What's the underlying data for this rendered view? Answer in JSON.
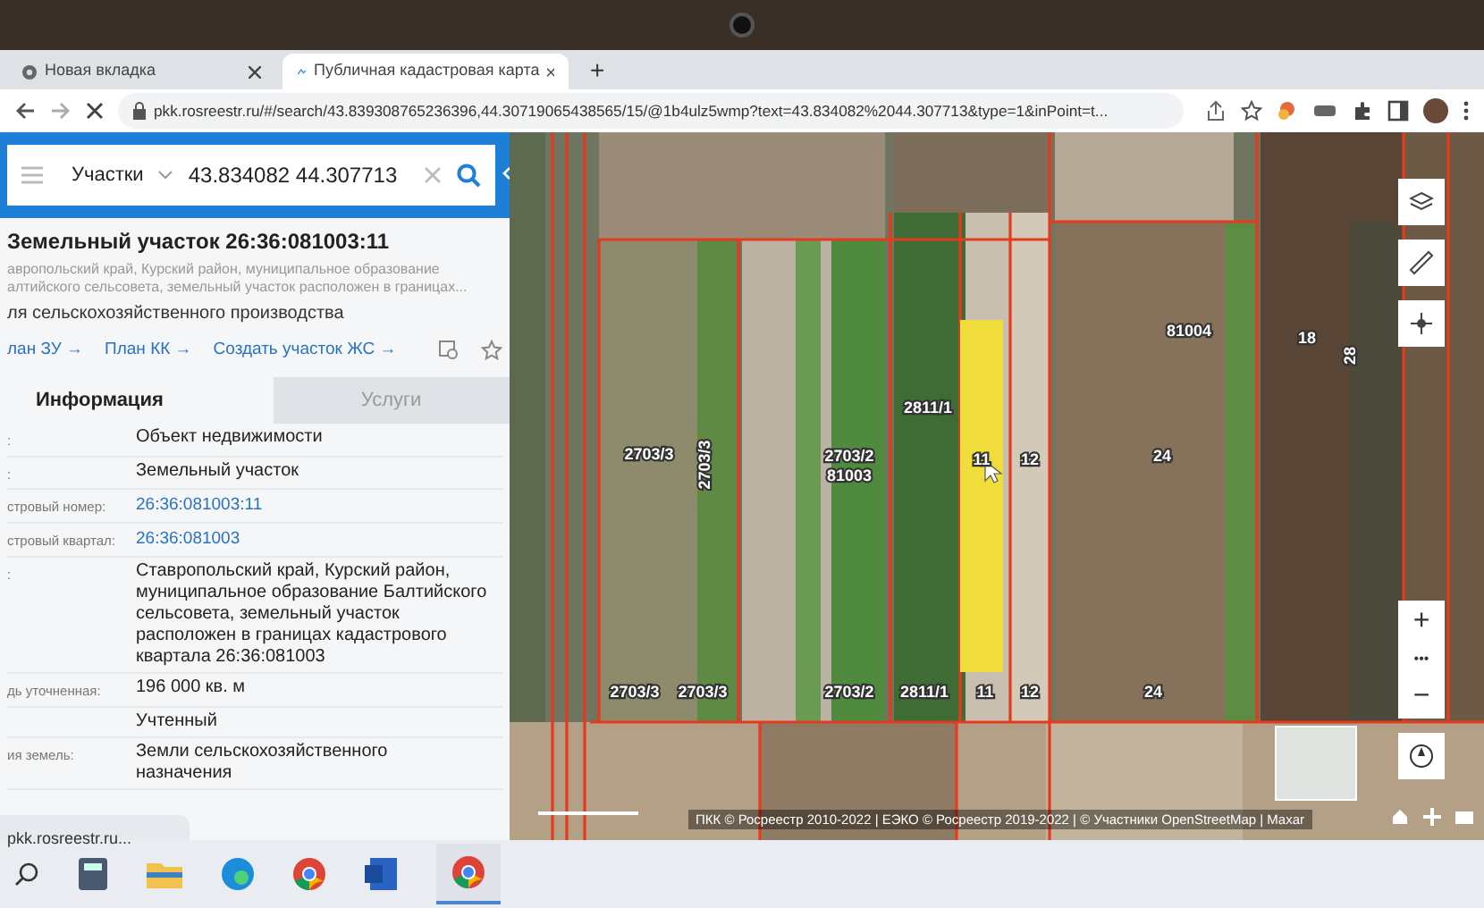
{
  "browser": {
    "tabs": [
      {
        "title": "Новая вкладка",
        "selected": false
      },
      {
        "title": "Публичная кадастровая карта",
        "selected": true
      }
    ],
    "new_tab": "+",
    "url": "pkk.rosreestr.ru/#/search/43.839308765236396,44.30719065438565/15/@1b4ulz5wmp?text=43.834082%2044.307713&type=1&inPoint=t..."
  },
  "search": {
    "category": "Участки",
    "value": "43.834082 44.307713"
  },
  "object": {
    "title": "Земельный участок 26:36:081003:11",
    "address": "авропольский край, Курский район, муниципальное образование\nалтийского сельсовета, земельный участок расположен в границах...",
    "usage": "ля сельскохозяйственного производства",
    "links": [
      "лан ЗУ →",
      "План КК →",
      "Создать участок ЖС →"
    ]
  },
  "tabs": [
    {
      "label": "Информация",
      "selected": true
    },
    {
      "label": "Услуги",
      "selected": false
    }
  ],
  "info_rows": [
    {
      "label": ":",
      "value": "Объект недвижимости",
      "kind": "text"
    },
    {
      "label": ":",
      "value": "Земельный участок",
      "kind": "text"
    },
    {
      "label": "стровый номер:",
      "value": "26:36:081003:11",
      "kind": "link"
    },
    {
      "label": "стровый квартал:",
      "value": "26:36:081003",
      "kind": "link"
    },
    {
      "label": ":",
      "value": "Ставропольский край, Курский район, муниципальное образование Балтийского сельсовета, земельный участок расположен в границах кадастрового квартала 26:36:081003",
      "kind": "text"
    },
    {
      "label": "дь уточненная:",
      "value": "196 000 кв. м",
      "kind": "text"
    },
    {
      "label": "",
      "value": "Учтенный",
      "kind": "text"
    },
    {
      "label": "ия земель:",
      "value": "Земли сельскохозяйственного назначения",
      "kind": "text"
    }
  ],
  "status_link": "pkk.rosreestr.ru...",
  "map": {
    "labels": [
      {
        "text": "2703/3",
        "vertical": false
      },
      {
        "text": "2703/3",
        "vertical": true
      },
      {
        "text": "2703/2",
        "vertical": false
      },
      {
        "text": "81003",
        "vertical": false
      },
      {
        "text": "2811/1",
        "vertical": false
      },
      {
        "text": "11",
        "vertical": false
      },
      {
        "text": "12",
        "vertical": false
      },
      {
        "text": "24",
        "vertical": false
      },
      {
        "text": "81004",
        "vertical": false
      },
      {
        "text": "18",
        "vertical": false
      },
      {
        "text": "28",
        "vertical": true
      },
      {
        "text": "2703/3",
        "vertical": false
      },
      {
        "text": "2703/3",
        "vertical": false
      },
      {
        "text": "2703/2",
        "vertical": false
      },
      {
        "text": "2811/1",
        "vertical": false
      },
      {
        "text": "11",
        "vertical": false
      },
      {
        "text": "12",
        "vertical": false
      },
      {
        "text": "24",
        "vertical": false
      }
    ],
    "zoom_in": "+",
    "more": "•••",
    "zoom_out": "−",
    "attribution": "ПКК © Росреестр 2010-2022 | ЕЭКО © Росреестр 2019-2022 | © Участники OpenStreetMap | Maxar"
  }
}
